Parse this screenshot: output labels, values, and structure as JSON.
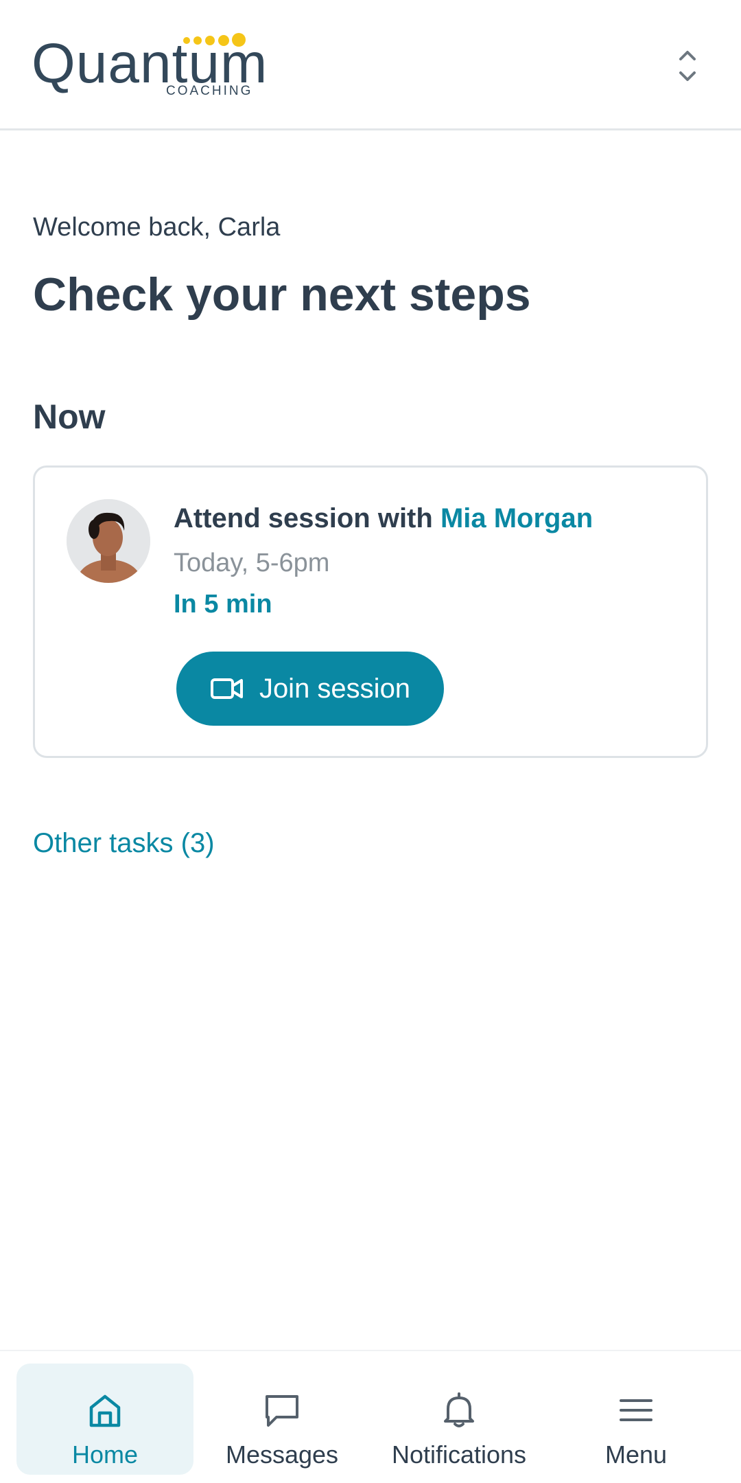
{
  "header": {
    "logo_word": "Quantum",
    "logo_sub": "COACHING",
    "accent": "#f5c518",
    "switcher_icon": "chevron-up-down-icon"
  },
  "main": {
    "welcome": "Welcome back, Carla",
    "title": "Check your next steps",
    "section_title": "Now",
    "card": {
      "title_prefix": "Attend session with ",
      "coach_name": "Mia Morgan",
      "time": "Today, 5-6pm",
      "countdown": "In 5 min",
      "join_label": "Join session",
      "join_icon": "video-camera-icon"
    },
    "other_tasks": "Other tasks (3)"
  },
  "bottom_nav": {
    "items": [
      {
        "label": "Home",
        "icon": "home-icon",
        "active": true
      },
      {
        "label": "Messages",
        "icon": "chat-icon",
        "active": false
      },
      {
        "label": "Notifications",
        "icon": "bell-icon",
        "active": false
      },
      {
        "label": "Menu",
        "icon": "hamburger-icon",
        "active": false
      }
    ]
  },
  "colors": {
    "primary": "#0a88a3",
    "text": "#2f3e4e",
    "muted": "#8a9299"
  }
}
